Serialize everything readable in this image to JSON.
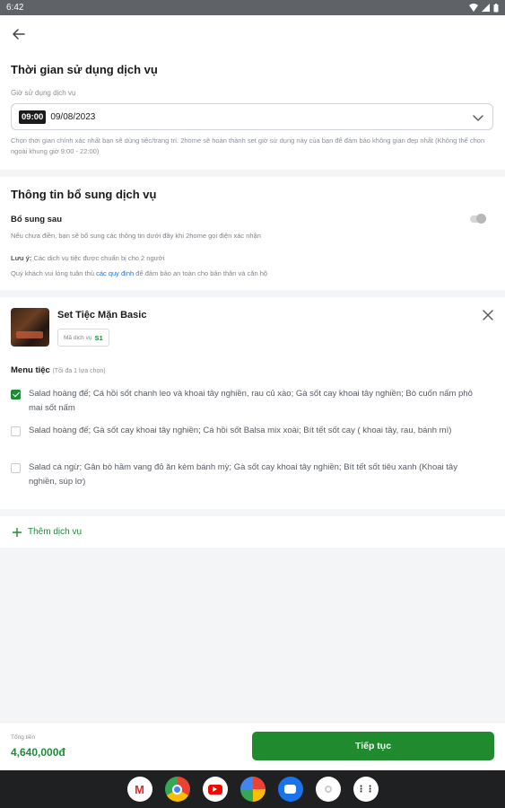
{
  "status_bar": {
    "time": "6:42"
  },
  "service_time": {
    "title": "Thời gian sử dụng dịch vụ",
    "field_label": "Giờ sử dụng dịch vụ",
    "time_value": "09:00",
    "date_value": "09/08/2023",
    "hint": "Chọn thời gian chính xác nhất bạn sẽ dùng tiệc/trang trí. 2home sẽ hoàn thành set giờ sử dụng này của bạn để đảm bảo không gian đẹp nhất (Không thể chọn ngoài khung giờ 9:00 - 22:00)"
  },
  "extra_info": {
    "title": "Thông tin bổ sung dịch vụ",
    "toggle_label": "Bổ sung sau",
    "toggle_on": false,
    "toggle_desc": "Nếu chưa điền, bạn sẽ bổ sung các thông tin dưới đây khi 2home gọi điện xác nhận",
    "note_prefix": "Lưu ý:",
    "note_text": "Các dịch vụ tiệc được chuẩn bị cho 2 người",
    "rule_before": "Quý khách vui lòng tuân thủ",
    "rule_link": "các quy định",
    "rule_after": "để đảm bảo an toàn cho bản thân và căn hộ"
  },
  "service_card": {
    "title": "Set Tiệc Mặn Basic",
    "code_label": "Mã dịch vụ",
    "code_value": "S1",
    "menu_label": "Menu tiệc",
    "menu_hint": "(Tối đa 1 lựa chọn)",
    "options": [
      {
        "text": "Salad hoàng đế; Cá hồi sốt chanh leo và khoai tây nghiền, rau củ xào; Gà sốt cay khoai tây nghiền; Bò cuốn nấm phô mai sốt nấm",
        "checked": true
      },
      {
        "text": "Salad hoàng đế; Gà sốt cay khoai tây nghiền; Cá hồi sốt Balsa mix xoài; Bít tết sốt cay ( khoai tây, rau, bánh mì)",
        "checked": false
      },
      {
        "text": "Salad cá ngừ; Gân bò hầm vang đỏ ăn kèm bánh mỳ; Gà sốt cay khoai tây nghiền; Bít tết sốt tiêu xanh (Khoai tây nghiền, súp lơ)",
        "checked": false
      }
    ]
  },
  "add_service": {
    "label": "Thêm dịch vụ"
  },
  "footer": {
    "total_label": "Tổng tiền",
    "total_value": "4,640,000đ",
    "cta_label": "Tiếp tục"
  },
  "dock": {
    "apps": [
      "gmail-icon",
      "chrome-icon",
      "youtube-icon",
      "photos-icon",
      "messages-icon",
      "camera-icon",
      "apps-icon"
    ]
  },
  "colors": {
    "brand_green": "#1f8a2e",
    "link_blue": "#1a73e8"
  }
}
